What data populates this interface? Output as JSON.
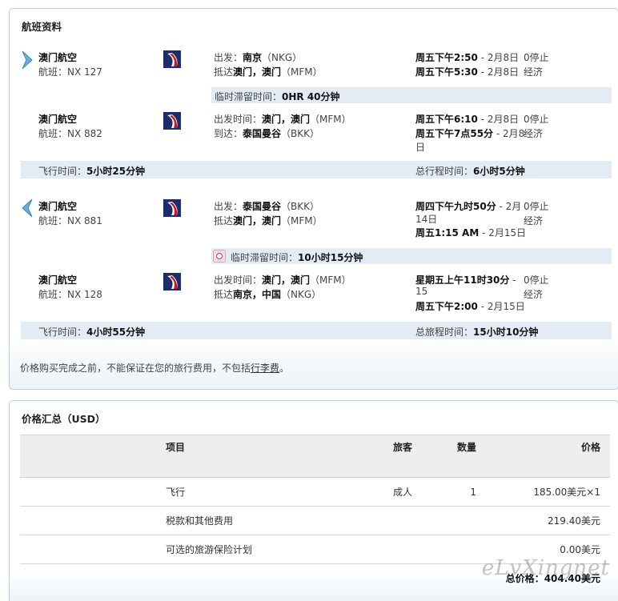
{
  "flight_panel": {
    "title": "航班资料",
    "outbound": {
      "segment1": {
        "airline": "澳门航空",
        "flight": "航班：NX 127",
        "dep_label": "出发：",
        "dep_city": "南京",
        "dep_code": "（NKG）",
        "arr_label": "抵达",
        "arr_city": "澳门，澳门",
        "arr_code": "（MFM）",
        "dep_time": "周五下午2:50",
        "dep_date": " - 2月8日",
        "arr_time": "周五下午5:30",
        "arr_date": " - 2月8日",
        "stops": "0停止",
        "cabin": "经济"
      },
      "layover": {
        "label": "临时滞留时间：",
        "value": "0HR 40分钟"
      },
      "segment2": {
        "airline": "澳门航空",
        "flight": "航班：NX 882",
        "dep_label": "出发时间：",
        "dep_city": "澳门，澳门",
        "dep_code": "（MFM）",
        "arr_label": "到达：",
        "arr_city": "泰国曼谷",
        "arr_code": "（BKK）",
        "dep_time": "周五下午6:10",
        "dep_date": " - 2月8日",
        "arr_time": "周五下午7点55分",
        "arr_date": " - 2月8",
        "arr_date2": "日",
        "stops": "0停止",
        "cabin": "经济"
      },
      "flight_time_label": "飞行时间：",
      "flight_time": "5小时25分钟",
      "total_label": "总行程时间：",
      "total": "6小时5分钟"
    },
    "inbound": {
      "segment1": {
        "airline": "澳门航空",
        "flight": "航班：NX 881",
        "dep_label": "出发：",
        "dep_city": "泰国曼谷",
        "dep_code": "（BKK）",
        "arr_label": "抵达",
        "arr_city": "澳门，澳门",
        "arr_code": "（MFM）",
        "dep_time": "周四下午九时50分",
        "dep_date": " - 2月",
        "dep_date2": "14日",
        "arr_time": "周五1:15 AM",
        "arr_date": " - 2月15日",
        "stops": "0停止",
        "cabin": "经济"
      },
      "layover": {
        "label": "临时滞留时间：",
        "value": "10小时15分钟"
      },
      "segment2": {
        "airline": "澳门航空",
        "flight": "航班：NX 128",
        "dep_label": "出发时间：",
        "dep_city": "澳门，澳门",
        "dep_code": "（MFM）",
        "arr_label": "抵达",
        "arr_city": "南京，中国",
        "arr_code": "（NKG）",
        "dep_time": "星期五上午11时30分",
        "dep_date": " -",
        "dep_date2": "15",
        "arr_time": "周五下午2:00",
        "arr_date": " - 2月15日",
        "stops": "0停止",
        "cabin": "经济"
      },
      "flight_time_label": "飞行时间：",
      "flight_time": "4小时55分钟",
      "total_label": "总旅程时间：",
      "total": "15小时10分钟"
    },
    "note_prefix": "价格购买完成之前，不能保证在您的旅行费用，不包括",
    "note_link": "行李费",
    "note_suffix": "。",
    "brand_colors": {
      "logo_blue": "#1d2c6b",
      "logo_red": "#d3141e",
      "arrow": "#6aaed8"
    },
    "icons": {
      "outbound": "chevron-right-icon",
      "inbound": "chevron-left-icon",
      "layover": "clock-icon"
    }
  },
  "price_panel": {
    "title": "价格汇总（USD）",
    "headers": {
      "item": "项目",
      "passenger": "旅客",
      "qty": "数量",
      "price": "价格"
    },
    "rows": [
      {
        "item": "飞行",
        "passenger": "成人",
        "qty": "1",
        "price": "185.00美元×1"
      },
      {
        "item": "税款和其他费用",
        "passenger": "",
        "qty": "",
        "price": "219.40美元"
      },
      {
        "item": "可选的旅游保险计划",
        "passenger": "",
        "qty": "",
        "price": "0.00美元"
      }
    ],
    "total_label": "总价格：",
    "total_value": "404.40美元"
  },
  "watermark": "eLvXingnet"
}
